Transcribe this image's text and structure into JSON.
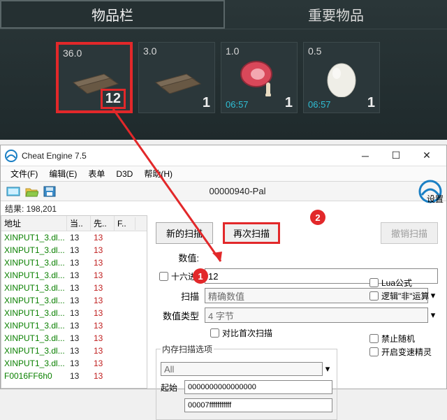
{
  "game": {
    "tabs": {
      "inventory": "物品栏",
      "important": "重要物品"
    },
    "slots": [
      {
        "weight": "36.0",
        "count": "12",
        "timer": ""
      },
      {
        "weight": "3.0",
        "count": "1",
        "timer": ""
      },
      {
        "weight": "1.0",
        "count": "1",
        "timer": "06:57"
      },
      {
        "weight": "0.5",
        "count": "1",
        "timer": "06:57"
      }
    ]
  },
  "ce": {
    "title": "Cheat Engine 7.5",
    "menu": {
      "file": "文件(F)",
      "edit": "编辑(E)",
      "table": "表单",
      "d3d": "D3D",
      "help": "帮助(H)"
    },
    "process": "00000940-Pal",
    "results_label": "结果: 198,201",
    "settings": "设置",
    "headers": {
      "addr": "地址",
      "cur": "当..",
      "prev": "先..",
      "f": "F.."
    },
    "rows": [
      {
        "addr": "XINPUT1_3.dl...",
        "cur": "13",
        "prev": "13"
      },
      {
        "addr": "XINPUT1_3.dl...",
        "cur": "13",
        "prev": "13"
      },
      {
        "addr": "XINPUT1_3.dl...",
        "cur": "13",
        "prev": "13"
      },
      {
        "addr": "XINPUT1_3.dl...",
        "cur": "13",
        "prev": "13"
      },
      {
        "addr": "XINPUT1_3.dl...",
        "cur": "13",
        "prev": "13"
      },
      {
        "addr": "XINPUT1_3.dl...",
        "cur": "13",
        "prev": "13"
      },
      {
        "addr": "XINPUT1_3.dl...",
        "cur": "13",
        "prev": "13"
      },
      {
        "addr": "XINPUT1_3.dl...",
        "cur": "13",
        "prev": "13"
      },
      {
        "addr": "XINPUT1_3.dl...",
        "cur": "13",
        "prev": "13"
      },
      {
        "addr": "XINPUT1_3.dl...",
        "cur": "13",
        "prev": "13"
      },
      {
        "addr": "XINPUT1_3.dl...",
        "cur": "13",
        "prev": "13"
      },
      {
        "addr": "F0016FF6h0",
        "cur": "13",
        "prev": "13"
      }
    ],
    "scan": {
      "new_scan": "新的扫描",
      "next_scan": "再次扫描",
      "undo_scan": "撤销扫描",
      "value_label": "数值:",
      "value": "12",
      "hex_label": "十六进制",
      "scan_type_label": "扫描",
      "scan_type": "精确数值",
      "value_type_label": "数值类型",
      "value_type": "4 字节",
      "lua": "Lua公式",
      "not": "逻辑\"非\"运算",
      "compare_first": "对比首次扫描",
      "no_random": "禁止随机",
      "speed_hack": "开启变速精灵",
      "mem_opts_title": "内存扫描选项",
      "mem_all": "All",
      "start_label": "起始",
      "start": "0000000000000000",
      "stop": "00007fffffffffff"
    }
  },
  "anno": {
    "n1": "1",
    "n2": "2"
  }
}
